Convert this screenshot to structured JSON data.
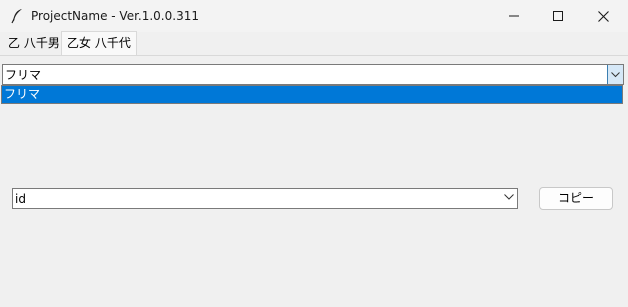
{
  "window": {
    "title": "ProjectName - Ver.1.0.0.311",
    "icon": "feather-icon",
    "controls": [
      "minimize-icon",
      "maximize-icon",
      "close-icon"
    ]
  },
  "tabs": [
    {
      "label": "乙 八千男",
      "selected": false
    },
    {
      "label": "乙女 八千代",
      "selected": true
    }
  ],
  "main_combo": {
    "value": "フリマ",
    "options": [
      "フリマ"
    ],
    "selected_option": "フリマ",
    "expanded": true
  },
  "field_combo": {
    "value": "id"
  },
  "copy_button": {
    "label": "コピー"
  },
  "colors": {
    "selection": "#0078d7",
    "background": "#f0f0f0"
  }
}
